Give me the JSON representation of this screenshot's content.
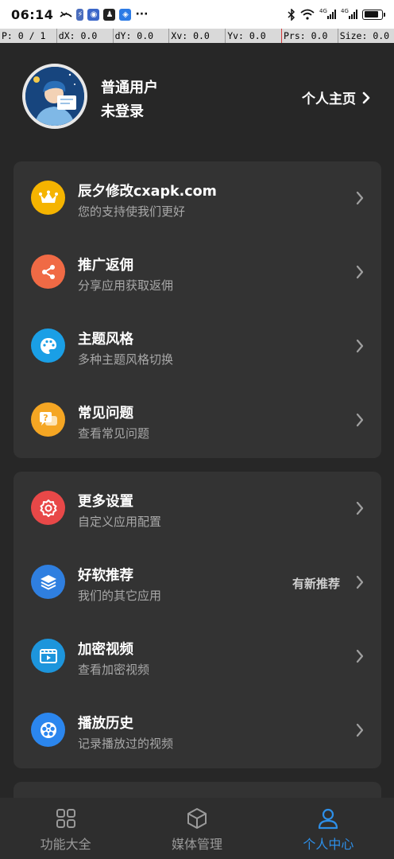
{
  "status_bar": {
    "time": "06:14",
    "signal_label_1": "4G",
    "signal_label_2": "4G",
    "battery_level": 0.85
  },
  "pointer_bar": {
    "cells": [
      "P: 0 / 1",
      "dX: 0.0",
      "dY: 0.0",
      "Xv: 0.0",
      "Yv: 0.0",
      "Prs: 0.0",
      "Size: 0.0"
    ]
  },
  "profile": {
    "username": "普通用户",
    "login_state": "未登录",
    "homepage_label": "个人主页"
  },
  "menu_group_1": [
    {
      "title": "辰夕修改cxapk.com",
      "subtitle": "您的支持使我们更好",
      "icon": "crown-icon",
      "color": "#f5b400"
    },
    {
      "title": "推广返佣",
      "subtitle": "分享应用获取返佣",
      "icon": "share-icon",
      "color": "#f06a45"
    },
    {
      "title": "主题风格",
      "subtitle": "多种主题风格切换",
      "icon": "palette-icon",
      "color": "#1a9fe6"
    },
    {
      "title": "常见问题",
      "subtitle": "查看常见问题",
      "icon": "question-icon",
      "color": "#f5a623"
    }
  ],
  "menu_group_2": [
    {
      "title": "更多设置",
      "subtitle": "自定义应用配置",
      "icon": "settings-icon",
      "color": "#e84848"
    },
    {
      "title": "好软推荐",
      "subtitle": "我们的其它应用",
      "icon": "layers-icon",
      "color": "#2f7fe0",
      "badge": "有新推荐"
    },
    {
      "title": "加密视频",
      "subtitle": "查看加密视频",
      "icon": "video-icon",
      "color": "#1d95dc"
    },
    {
      "title": "播放历史",
      "subtitle": "记录播放过的视频",
      "icon": "film-reel-icon",
      "color": "#2b86ee"
    }
  ],
  "bottom_nav": [
    {
      "label": "功能大全",
      "icon": "grid-icon",
      "active": false
    },
    {
      "label": "媒体管理",
      "icon": "cube-icon",
      "active": false
    },
    {
      "label": "个人中心",
      "icon": "person-icon",
      "active": true
    }
  ],
  "colors": {
    "background": "#272727",
    "card": "#333333",
    "accent": "#2d8fe8"
  }
}
